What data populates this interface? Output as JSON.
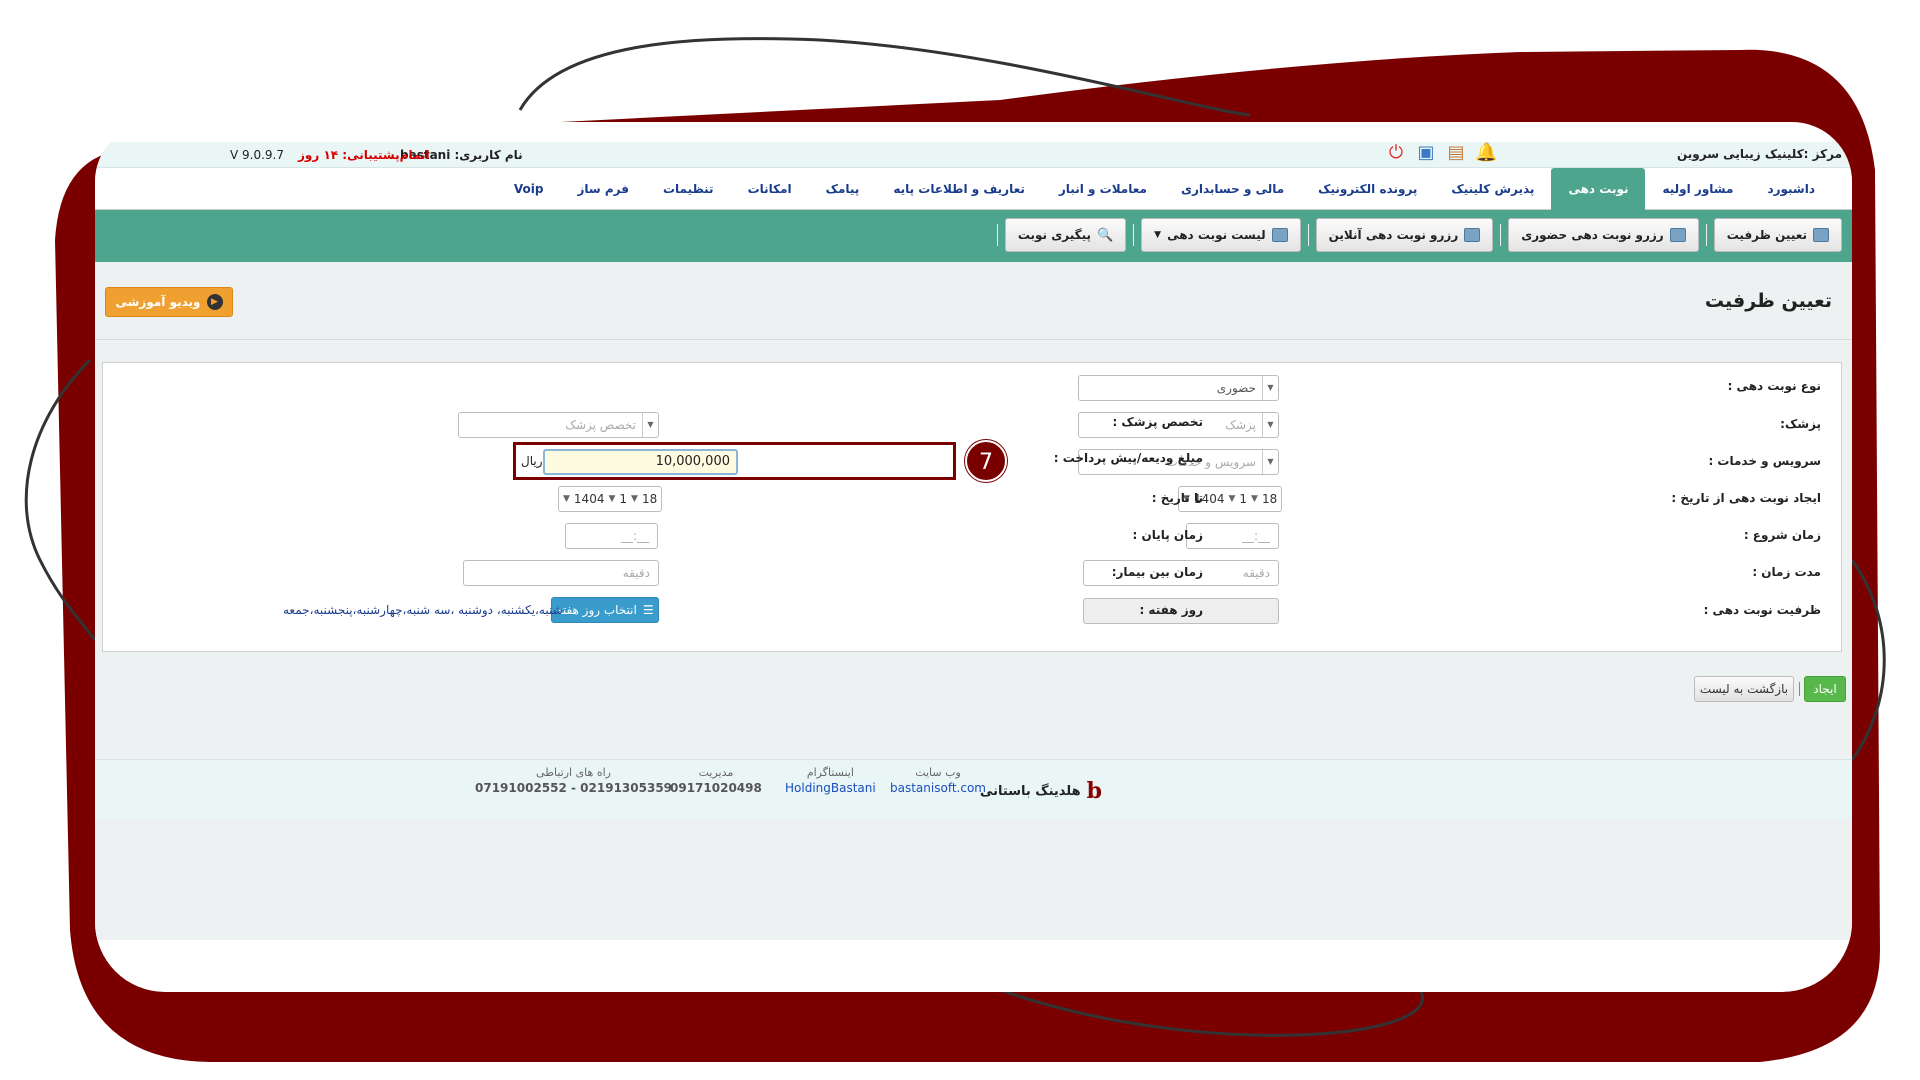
{
  "topbar": {
    "center_name": "مرکز :کلینیک زیبایی سروین",
    "user_label": "نام کاربری: bastani",
    "support_label": "اتمام‌پشتیبانی: ۱۴ روز",
    "version": "V 9.0.9.7",
    "icons": [
      "bell-icon",
      "calendar-icon",
      "calendar-check-icon",
      "power-icon"
    ]
  },
  "menu": {
    "items": [
      "داشبورد",
      "مشاور اولیه",
      "نوبت دهی",
      "پذیرش کلینیک",
      "پرونده الکترونیک",
      "مالی و حسابداری",
      "معاملات و انبار",
      "تعاریف و اطلاعات پایه",
      "پیامک",
      "امکانات",
      "تنظیمات",
      "فرم ساز",
      "Voip"
    ],
    "active": "نوبت دهی"
  },
  "toolbar": {
    "buttons": [
      "تعیین ظرفیت",
      "رزرو نوبت دهی حضوری",
      "رزرو نوبت دهی آنلاین",
      "لیست نوبت دهی",
      "پیگیری نوبت"
    ]
  },
  "page": {
    "title": "تعیین ظرفیت",
    "video_button": "ویدیو آموزشی"
  },
  "form": {
    "appointment_type": {
      "label": "نوع نوبت دهی :",
      "value": "حضوری"
    },
    "doctor": {
      "label": "پزشک:",
      "placeholder": "پزشک"
    },
    "specialty": {
      "label": "تخصص پزشک :",
      "placeholder": "تخصص پزشک"
    },
    "service": {
      "label": "سرویس و خدمات :",
      "placeholder": "سرویس و خدمات"
    },
    "deposit": {
      "label": "مبلغ ودیعه/پیش پرداخت :",
      "value": "10,000,000",
      "unit": "ریال"
    },
    "from_date": {
      "label": "ایجاد نوبت دهی از تاریخ :",
      "day": "18",
      "month": "1",
      "year": "1404"
    },
    "to_date": {
      "label": "تا تاریخ :",
      "day": "18",
      "month": "1",
      "year": "1404"
    },
    "start_time": {
      "label": "زمان شروع :",
      "placeholder": "__:__"
    },
    "end_time": {
      "label": "زمان پایان :",
      "placeholder": "__:__"
    },
    "duration": {
      "label": "مدت زمان :",
      "placeholder": "دقیقه"
    },
    "between_patients": {
      "label": "زمان بین بیمار:",
      "placeholder": "دقیقه"
    },
    "capacity": {
      "label": "ظرفیت نوبت دهی :",
      "value": ""
    },
    "weekday": {
      "label": "روز هفته :",
      "button": "انتخاب روز هفته",
      "selected": "شنبه،یکشنبه، دوشنبه ،سه شنبه،چهارشنبه،پنجشنبه،جمعه"
    },
    "step_number": "7"
  },
  "actions": {
    "create": "ایجاد",
    "back": "بازگشت به لیست"
  },
  "footer": {
    "brand": "هلدینگ باستانی",
    "website": {
      "title": "وب سایت",
      "value": "bastanisoft.com"
    },
    "instagram": {
      "title": "اینستاگرام",
      "value": "HoldingBastani"
    },
    "management": {
      "title": "مدیریت",
      "value": "09171020498"
    },
    "contact": {
      "title": "راه های ارتباطی",
      "value": "07191002552 - 02191305359"
    }
  },
  "colors": {
    "frame": "#7a0000",
    "teal": "#4ea58e",
    "orange": "#f0a030",
    "blue_button": "#3a9ccc",
    "green_button": "#59b84b"
  }
}
